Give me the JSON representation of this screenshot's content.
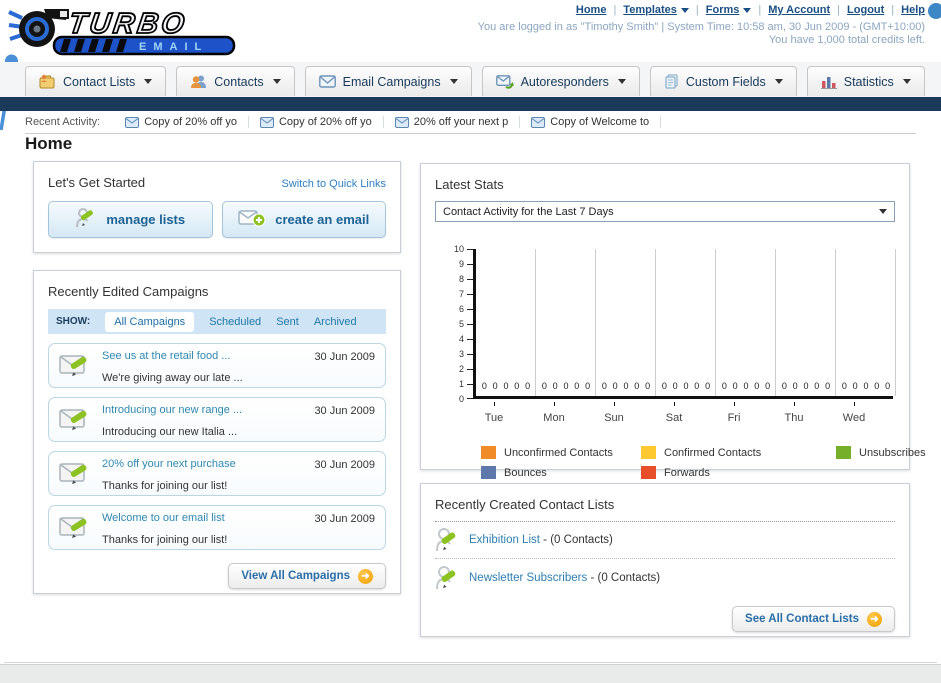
{
  "colors": {
    "navy_bar": "#1b3a5a",
    "link_navy": "#1a4f84",
    "link_teal": "#2f7fc1",
    "button_orange": "#f0a000",
    "muted_blue_text": "#8ca6c0"
  },
  "header": {
    "logo_title": "TURBO",
    "logo_subtitle": "EMAIL",
    "links": [
      {
        "label": "Home",
        "dropdown": false
      },
      {
        "label": "Templates",
        "dropdown": true
      },
      {
        "label": "Forms",
        "dropdown": true
      },
      {
        "label": "My Account",
        "dropdown": false
      },
      {
        "label": "Logout",
        "dropdown": false
      },
      {
        "label": "Help",
        "dropdown": false
      }
    ],
    "login_line": "You are logged in as \"Timothy Smith\" | System Time: 10:58 am, 30 Jun 2009 - (GMT+10:00)",
    "credits_line": "You have 1,000 total credits left."
  },
  "nav": {
    "tabs": [
      {
        "label": "Contact Lists",
        "icon": "contact-lists-icon"
      },
      {
        "label": "Contacts",
        "icon": "contacts-icon"
      },
      {
        "label": "Email Campaigns",
        "icon": "email-campaigns-icon"
      },
      {
        "label": "Autoresponders",
        "icon": "autoresponders-icon"
      },
      {
        "label": "Custom Fields",
        "icon": "custom-fields-icon"
      },
      {
        "label": "Statistics",
        "icon": "statistics-icon"
      }
    ]
  },
  "recent_activity": {
    "label": "Recent Activity:",
    "items": [
      {
        "title": "Copy of 20% off yo"
      },
      {
        "title": "Copy of 20% off yo"
      },
      {
        "title": "20% off your next p"
      },
      {
        "title": "Copy of Welcome to"
      }
    ]
  },
  "home": {
    "title": "Home"
  },
  "get_started": {
    "title": "Let's Get Started",
    "switch_link": "Switch to Quick Links",
    "manage_lists_label": "manage lists",
    "create_email_label": "create an email"
  },
  "campaigns": {
    "title": "Recently Edited Campaigns",
    "show_label": "SHOW:",
    "filters": [
      {
        "label": "All Campaigns",
        "active": true
      },
      {
        "label": "Scheduled",
        "active": false
      },
      {
        "label": "Sent",
        "active": false
      },
      {
        "label": "Archived",
        "active": false
      }
    ],
    "items": [
      {
        "title": "See us at the retail food ...",
        "subtitle": "We're giving away our late ...",
        "date": "30 Jun 2009"
      },
      {
        "title": "Introducing our new range ...",
        "subtitle": "Introducing our new Italia ...",
        "date": "30 Jun 2009"
      },
      {
        "title": "20% off your next purchase",
        "subtitle": "Thanks for joining our list!",
        "date": "30 Jun 2009"
      },
      {
        "title": "Welcome to our email list",
        "subtitle": "Thanks for joining our list!",
        "date": "30 Jun 2009"
      }
    ],
    "view_all_label": "View All Campaigns"
  },
  "stats": {
    "title": "Latest Stats",
    "dropdown_value": "Contact Activity for the Last 7 Days"
  },
  "chart_data": {
    "type": "bar",
    "title": "Contact Activity for the Last 7 Days",
    "categories": [
      "Tue",
      "Mon",
      "Sun",
      "Sat",
      "Fri",
      "Thu",
      "Wed"
    ],
    "series": [
      {
        "name": "Unconfirmed Contacts",
        "color": "#f08c28",
        "values": [
          0,
          0,
          0,
          0,
          0,
          0,
          0
        ]
      },
      {
        "name": "Confirmed Contacts",
        "color": "#fdc830",
        "values": [
          0,
          0,
          0,
          0,
          0,
          0,
          0
        ]
      },
      {
        "name": "Unsubscribes",
        "color": "#76b02a",
        "values": [
          0,
          0,
          0,
          0,
          0,
          0,
          0
        ]
      },
      {
        "name": "Bounces",
        "color": "#5f78ab",
        "values": [
          0,
          0,
          0,
          0,
          0,
          0,
          0
        ]
      },
      {
        "name": "Forwards",
        "color": "#e64f2a",
        "values": [
          0,
          0,
          0,
          0,
          0,
          0,
          0
        ]
      }
    ],
    "ylim": [
      0,
      10
    ],
    "ytick_step": 1,
    "grid": "vertical",
    "legend_position": "bottom"
  },
  "contact_lists": {
    "title": "Recently Created Contact Lists",
    "items": [
      {
        "name": "Exhibition List",
        "sep": "-",
        "count": "(0 Contacts)"
      },
      {
        "name": "Newsletter Subscribers",
        "sep": "-",
        "count": "(0 Contacts)"
      }
    ],
    "see_all_label": "See All Contact Lists"
  }
}
